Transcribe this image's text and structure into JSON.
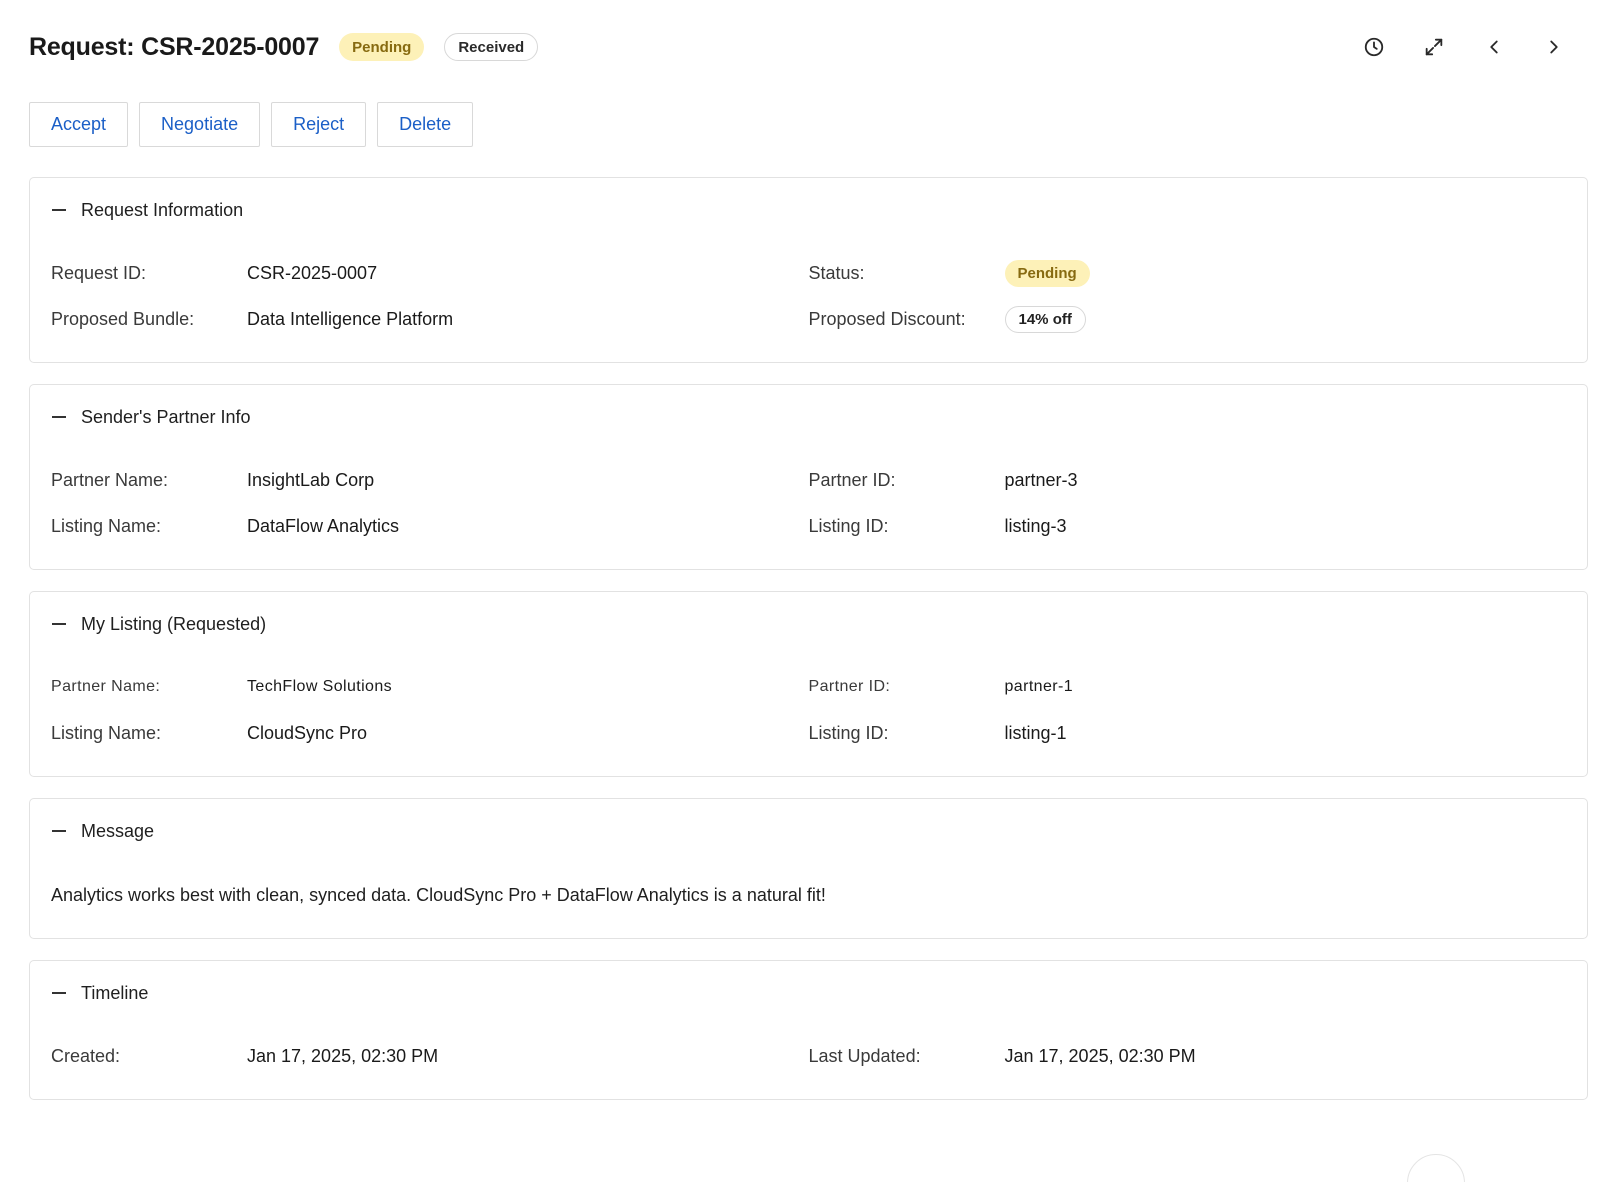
{
  "header": {
    "title": "Request: CSR-2025-0007",
    "status_badge": "Pending",
    "direction_badge": "Received",
    "icons": [
      "history-icon",
      "expand-icon",
      "chevron-left-icon",
      "chevron-right-icon"
    ]
  },
  "toolbar": {
    "accept_label": "Accept",
    "negotiate_label": "Negotiate",
    "reject_label": "Reject",
    "delete_label": "Delete"
  },
  "request_info": {
    "title": "Request Information",
    "request_id_label": "Request ID:",
    "request_id": "CSR-2025-0007",
    "status_label": "Status:",
    "status": "Pending",
    "bundle_label": "Proposed Bundle:",
    "bundle": "Data Intelligence Platform",
    "discount_label": "Proposed Discount:",
    "discount": "14% off"
  },
  "sender_partner": {
    "title": "Sender's Partner Info",
    "partner_name_label": "Partner Name:",
    "partner_name": "InsightLab Corp",
    "partner_id_label": "Partner ID:",
    "partner_id": "partner-3",
    "listing_name_label": "Listing Name:",
    "listing_name": "DataFlow Analytics",
    "listing_id_label": "Listing ID:",
    "listing_id": "listing-3"
  },
  "my_listing": {
    "title": "My Listing (Requested)",
    "partner_name_label": "Partner Name:",
    "partner_name": "TechFlow Solutions",
    "partner_id_label": "Partner ID:",
    "partner_id": "partner-1",
    "listing_name_label": "Listing Name:",
    "listing_name": "CloudSync Pro",
    "listing_id_label": "Listing ID:",
    "listing_id": "listing-1"
  },
  "message": {
    "title": "Message",
    "text": "Analytics works best with clean, synced data. CloudSync Pro + DataFlow Analytics is a natural fit!"
  },
  "timeline": {
    "title": "Timeline",
    "created_label": "Created:",
    "created": "Jan 17, 2025, 02:30 PM",
    "updated_label": "Last Updated:",
    "updated": "Jan 17, 2025, 02:30 PM"
  },
  "colors": {
    "accent": "#1b5fc7",
    "pending_bg": "#fdf1b8",
    "pending_text": "#876a10",
    "border": "#e2e2e2"
  }
}
